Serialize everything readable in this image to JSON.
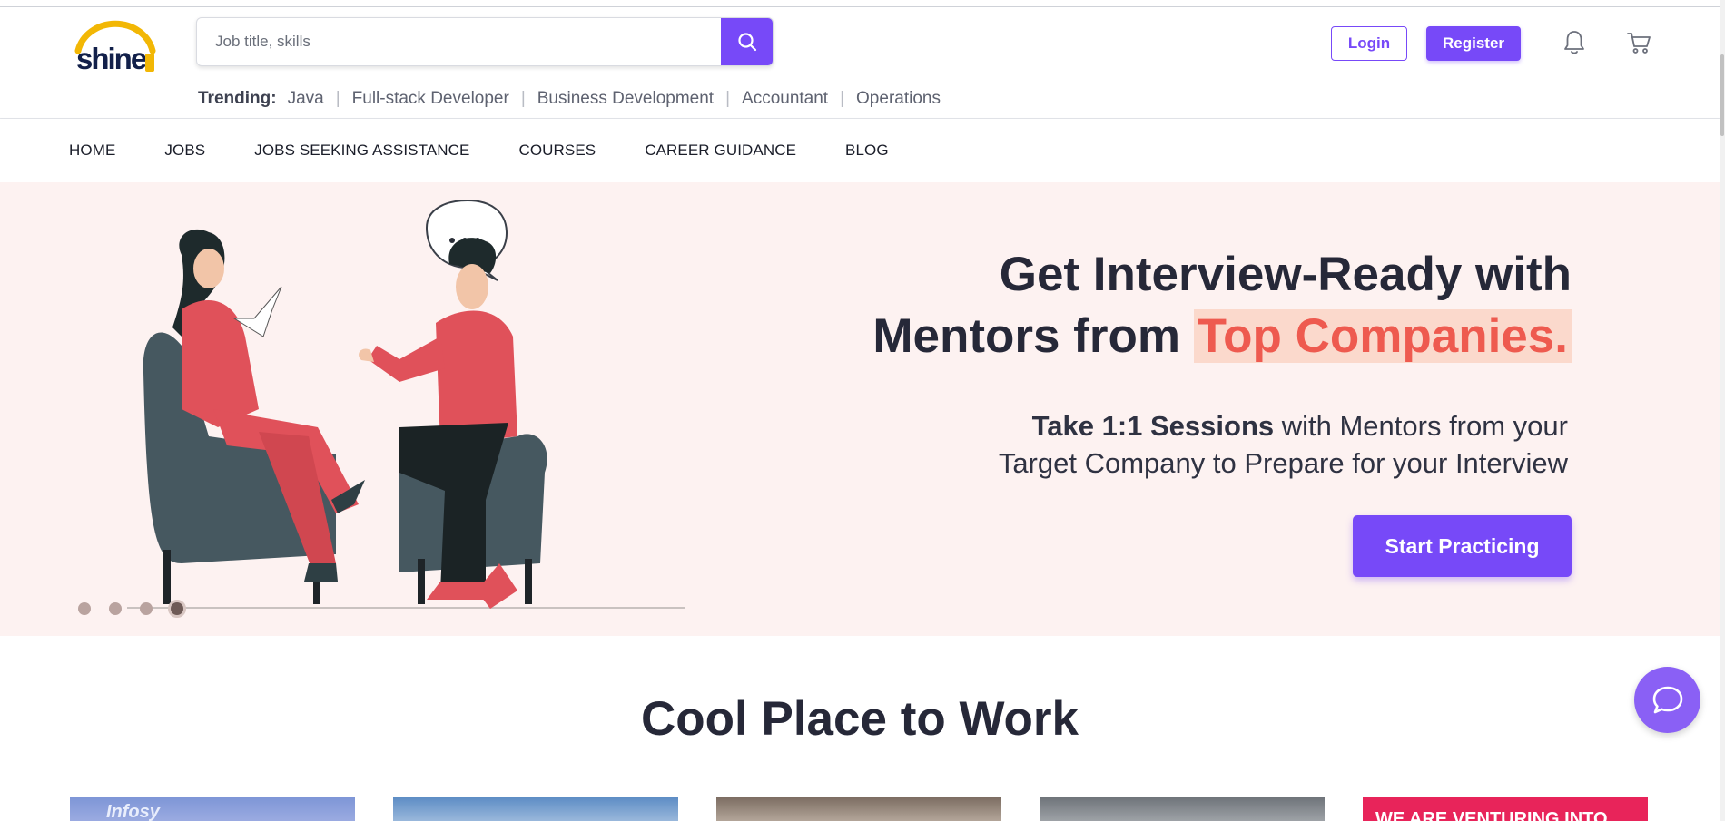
{
  "header": {
    "logo_text": "shine",
    "search": {
      "placeholder": "Job title, skills"
    },
    "trending_label": "Trending:",
    "trending": [
      "Java",
      "Full-stack Developer",
      "Business Development",
      "Accountant",
      "Operations"
    ],
    "login_label": "Login",
    "register_label": "Register"
  },
  "nav": {
    "items": [
      "HOME",
      "JOBS",
      "JOBS SEEKING ASSISTANCE",
      "COURSES",
      "CAREER GUIDANCE",
      "BLOG"
    ]
  },
  "hero": {
    "title_line1": "Get Interview-Ready with",
    "title_line2_prefix": "Mentors from ",
    "title_line2_highlight": "Top Companies.",
    "subtitle_bold": "Take 1:1 Sessions",
    "subtitle_rest1": " with Mentors from your",
    "subtitle_line2": "Target Company to Prepare for your Interview",
    "cta_label": "Start Practicing",
    "slides_total": 4,
    "active_slide": 4
  },
  "section": {
    "title": "Cool Place to Work"
  },
  "cards": {
    "card1_text": "Infosy",
    "card5_text": "WE ARE VENTURING INTO"
  },
  "colors": {
    "accent": "#7749f8",
    "hero_bg": "#fdf2f1",
    "highlight_text": "#ee5a4f",
    "highlight_bg": "#fbd9cc",
    "heading": "#262838"
  },
  "icons": [
    "search-icon",
    "bell-icon",
    "cart-icon",
    "chat-icon"
  ]
}
